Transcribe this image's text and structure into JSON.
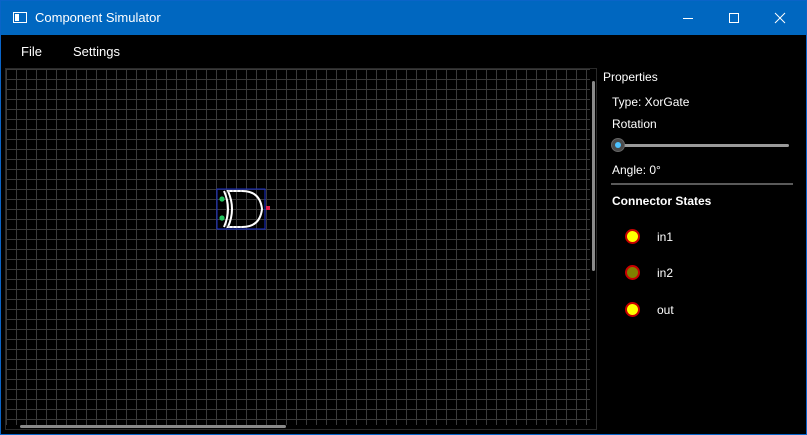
{
  "window": {
    "title": "Component Simulator",
    "controls": {
      "minimize_icon": "minimize-icon",
      "maximize_icon": "maximize-icon",
      "close_icon": "close-icon"
    }
  },
  "menu": {
    "items": [
      {
        "label": "File"
      },
      {
        "label": "Settings"
      }
    ]
  },
  "canvas": {
    "component": {
      "type": "XorGate"
    },
    "selection_color": "#1a2fd0",
    "input_pin_color": "#22c55e",
    "output_pin_color": "#e11d48"
  },
  "properties": {
    "header": "Properties",
    "type_label": "Type: XorGate",
    "rotation_label": "Rotation",
    "rotation_value": 0,
    "angle_label": "Angle: 0°",
    "connector_states_title": "Connector States",
    "connectors": [
      {
        "name": "in1",
        "color": "#ffff00"
      },
      {
        "name": "in2",
        "color": "#808000"
      },
      {
        "name": "out",
        "color": "#ffff00"
      }
    ]
  },
  "colors": {
    "titlebar": "#0067c0",
    "accent": "#4cc2ff"
  }
}
